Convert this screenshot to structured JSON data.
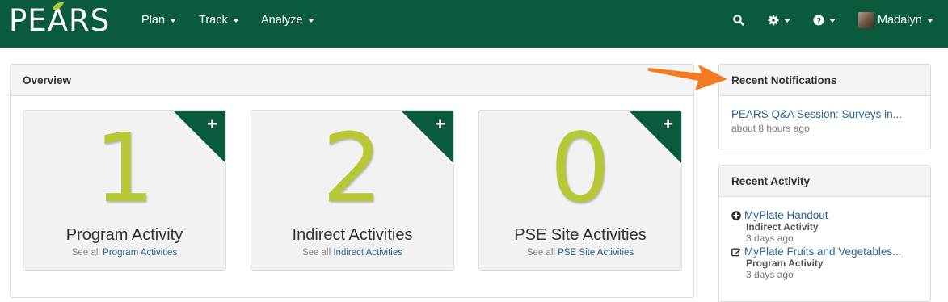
{
  "brand": {
    "logo_text": "PEARS",
    "primary_color": "#0a5b3c",
    "accent_color": "#b7c837"
  },
  "nav": {
    "menus": [
      {
        "label": "Plan"
      },
      {
        "label": "Track"
      },
      {
        "label": "Analyze"
      }
    ],
    "icons": [
      "search-icon",
      "gear-icon",
      "help-icon"
    ],
    "user_name": "Madalyn"
  },
  "overview": {
    "title": "Overview",
    "cards": [
      {
        "count": "1",
        "title": "Program Activity",
        "see_all": "See all",
        "link": "Program Activities"
      },
      {
        "count": "2",
        "title": "Indirect Activities",
        "see_all": "See all",
        "link": "Indirect Activities"
      },
      {
        "count": "0",
        "title": "PSE Site Activities",
        "see_all": "See all",
        "link": "PSE Site Activities"
      }
    ]
  },
  "notifications": {
    "title": "Recent Notifications",
    "items": [
      {
        "text": "PEARS Q&A Session: Surveys in...",
        "time": "about 8 hours ago"
      }
    ]
  },
  "activity": {
    "title": "Recent Activity",
    "items": [
      {
        "icon": "plus-circle-icon",
        "name": "MyPlate Handout",
        "type": "Indirect Activity",
        "time": "3 days ago"
      },
      {
        "icon": "edit-icon",
        "name": "MyPlate Fruits and Vegetables...",
        "type": "Program Activity",
        "time": "3 days ago"
      }
    ]
  },
  "annotation": {
    "icon": "orange-arrow-icon",
    "color": "#f47b20"
  }
}
